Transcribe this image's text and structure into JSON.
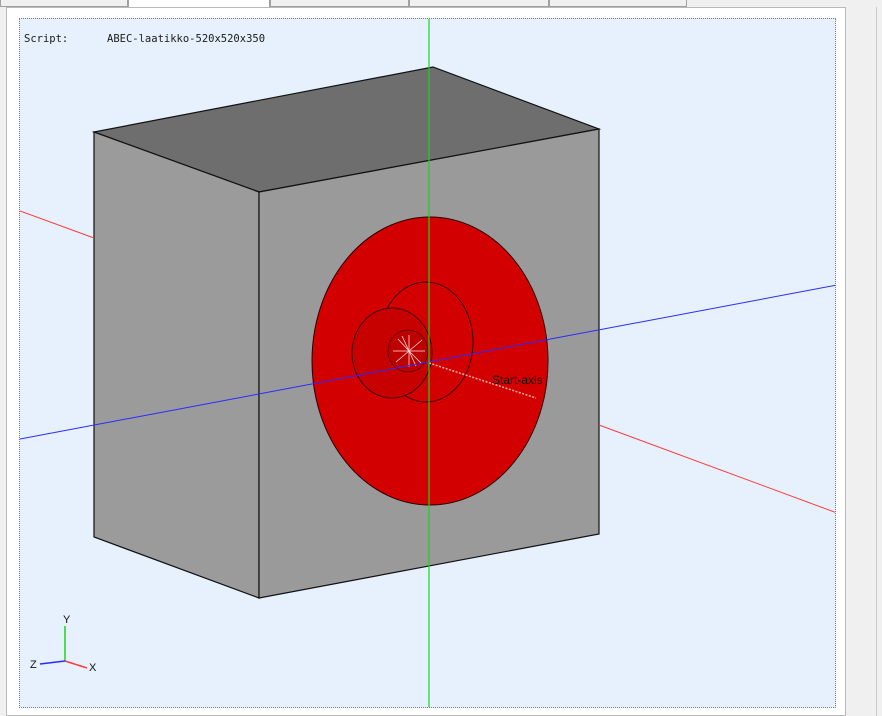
{
  "script": {
    "label": "Script:",
    "name": "ABEC-laatikko-520x520x350"
  },
  "scene": {
    "axis_label": "Start-axis",
    "triad": {
      "y": "Y",
      "z": "Z",
      "x": "X"
    },
    "colors": {
      "background": "#e6f1fd",
      "box_top": "#6e6e6e",
      "box_left": "#9b9b9b",
      "box_front": "#9a9a9a",
      "driver": "#d30000",
      "x_axis": "#ff3b3b",
      "y_axis": "#19d619",
      "z_axis": "#2a2aff"
    }
  }
}
